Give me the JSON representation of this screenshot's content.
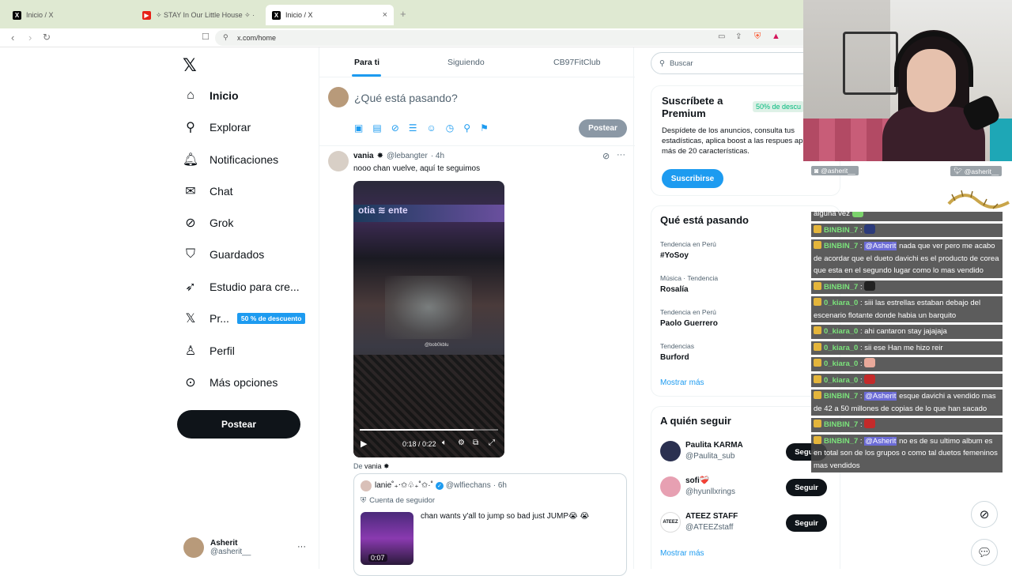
{
  "browser": {
    "tabs": [
      {
        "title": "Inicio / X",
        "icon": "x-logo-icon"
      },
      {
        "title": "✧ STAY In Our Little House ✧ ·",
        "icon": "youtube-icon"
      },
      {
        "title": "Inicio / X",
        "icon": "x-logo-icon",
        "active": true
      }
    ],
    "url": "x.com/home",
    "accent_tab_bar": "#dfe9d2"
  },
  "sidebar": {
    "logo": "𝕏",
    "items": [
      {
        "label": "Inicio",
        "icon": "home-icon",
        "active": true
      },
      {
        "label": "Explorar",
        "icon": "search-icon"
      },
      {
        "label": "Notificaciones",
        "icon": "bell-icon"
      },
      {
        "label": "Chat",
        "icon": "mail-icon"
      },
      {
        "label": "Grok",
        "icon": "grok-icon"
      },
      {
        "label": "Guardados",
        "icon": "bookmark-icon"
      },
      {
        "label": "Estudio para cre...",
        "icon": "rocket-icon"
      },
      {
        "label": "Pr...",
        "icon": "x-premium-icon",
        "badge": "50 % de descuento"
      },
      {
        "label": "Perfil",
        "icon": "person-icon"
      },
      {
        "label": "Más opciones",
        "icon": "more-circle-icon"
      }
    ],
    "post_button": "Postear",
    "account": {
      "name": "Asherit",
      "handle": "@asherit__",
      "more": "···"
    }
  },
  "feed": {
    "tabs": [
      "Para ti",
      "Siguiendo",
      "CB97FitClub"
    ],
    "composer_placeholder": "¿Qué está pasando?",
    "post_button": "Postear",
    "tweet": {
      "name": "vania",
      "verified_mark": "✸",
      "handle": "@lebangter",
      "time": "· 4h",
      "text": "nooo chan vuelve, aquí te seguimos",
      "video_time": "0:18 / 0:22",
      "video_progress": 0.82,
      "video_watermark": "@bob0kblu",
      "from_label": "De",
      "from_name": "vania ✸"
    },
    "quote": {
      "name": "lanie˚₊‧✩♧₊˚✩·˚",
      "handle": "@wlfiechans",
      "time": "· 6h",
      "context": "Cuenta de seguidor",
      "text": "chan wants y'all to jump so bad just JUMP😭 😭",
      "video_duration": "0:07"
    }
  },
  "right": {
    "search_placeholder": "Buscar",
    "premium": {
      "title": "Suscríbete a Premium",
      "badge": "50% de descu",
      "body": "Despídete de los anuncios, consulta tus estadísticas, aplica boost a las respues aprovecha más de 20 características.",
      "button": "Suscribirse"
    },
    "trending": {
      "title": "Qué está pasando",
      "items": [
        {
          "meta": "Tendencia en Perú",
          "name": "#YoSoy"
        },
        {
          "meta": "Música · Tendencia",
          "name": "Rosalía"
        },
        {
          "meta": "Tendencia en Perú",
          "name": "Paolo Guerrero"
        },
        {
          "meta": "Tendencias",
          "name": "Burford"
        }
      ],
      "more": "Mostrar más"
    },
    "who_to_follow": {
      "title": "A quién seguir",
      "people": [
        {
          "name": "Paulita KARMA",
          "handle": "@Paulita_sub",
          "button": "Seguir"
        },
        {
          "name": "sofi❤️‍🩹",
          "handle": "@hyunllxrings",
          "button": "Seguir"
        },
        {
          "name": "ATEEZ STAFF",
          "handle": "@ATEEZstaff",
          "button": "Seguir"
        }
      ],
      "more": "Mostrar más"
    }
  },
  "stream": {
    "name_tags": [
      "@asherit__",
      "@asherit__"
    ],
    "chat": [
      {
        "user": "",
        "text": "alguna vez"
      },
      {
        "user": "BINBIN_7",
        "text": ":"
      },
      {
        "user": "BINBIN_7",
        "mention": "@Asherit",
        "text": "nada que ver pero me acabo de acordar que el dueto davichi es el producto de corea que esta en el segundo lugar como lo mas vendido"
      },
      {
        "user": "BINBIN_7",
        "text": ":"
      },
      {
        "user": "0_kiara_0",
        "text": ": siii las estrellas estaban debajo del escenario flotante donde habia un barquito"
      },
      {
        "user": "0_kiara_0",
        "text": ": ahi cantaron stay jajajaja"
      },
      {
        "user": "0_kiara_0",
        "text": ": sii ese Han me hizo reir"
      },
      {
        "user": "0_kiara_0",
        "text": ":"
      },
      {
        "user": "0_kiara_0",
        "text": ":"
      },
      {
        "user": "BINBIN_7",
        "mention": "@Asherit",
        "text": "esque davichi a vendido mas de 42 a 50 millones de copias de lo que han sacado"
      },
      {
        "user": "BINBIN_7",
        "text": ":"
      },
      {
        "user": "BINBIN_7",
        "mention": "@Asherit",
        "text": "no es de su ultimo album es en total son de los grupos o como tal duetos femeninos mas vendidos"
      }
    ]
  }
}
